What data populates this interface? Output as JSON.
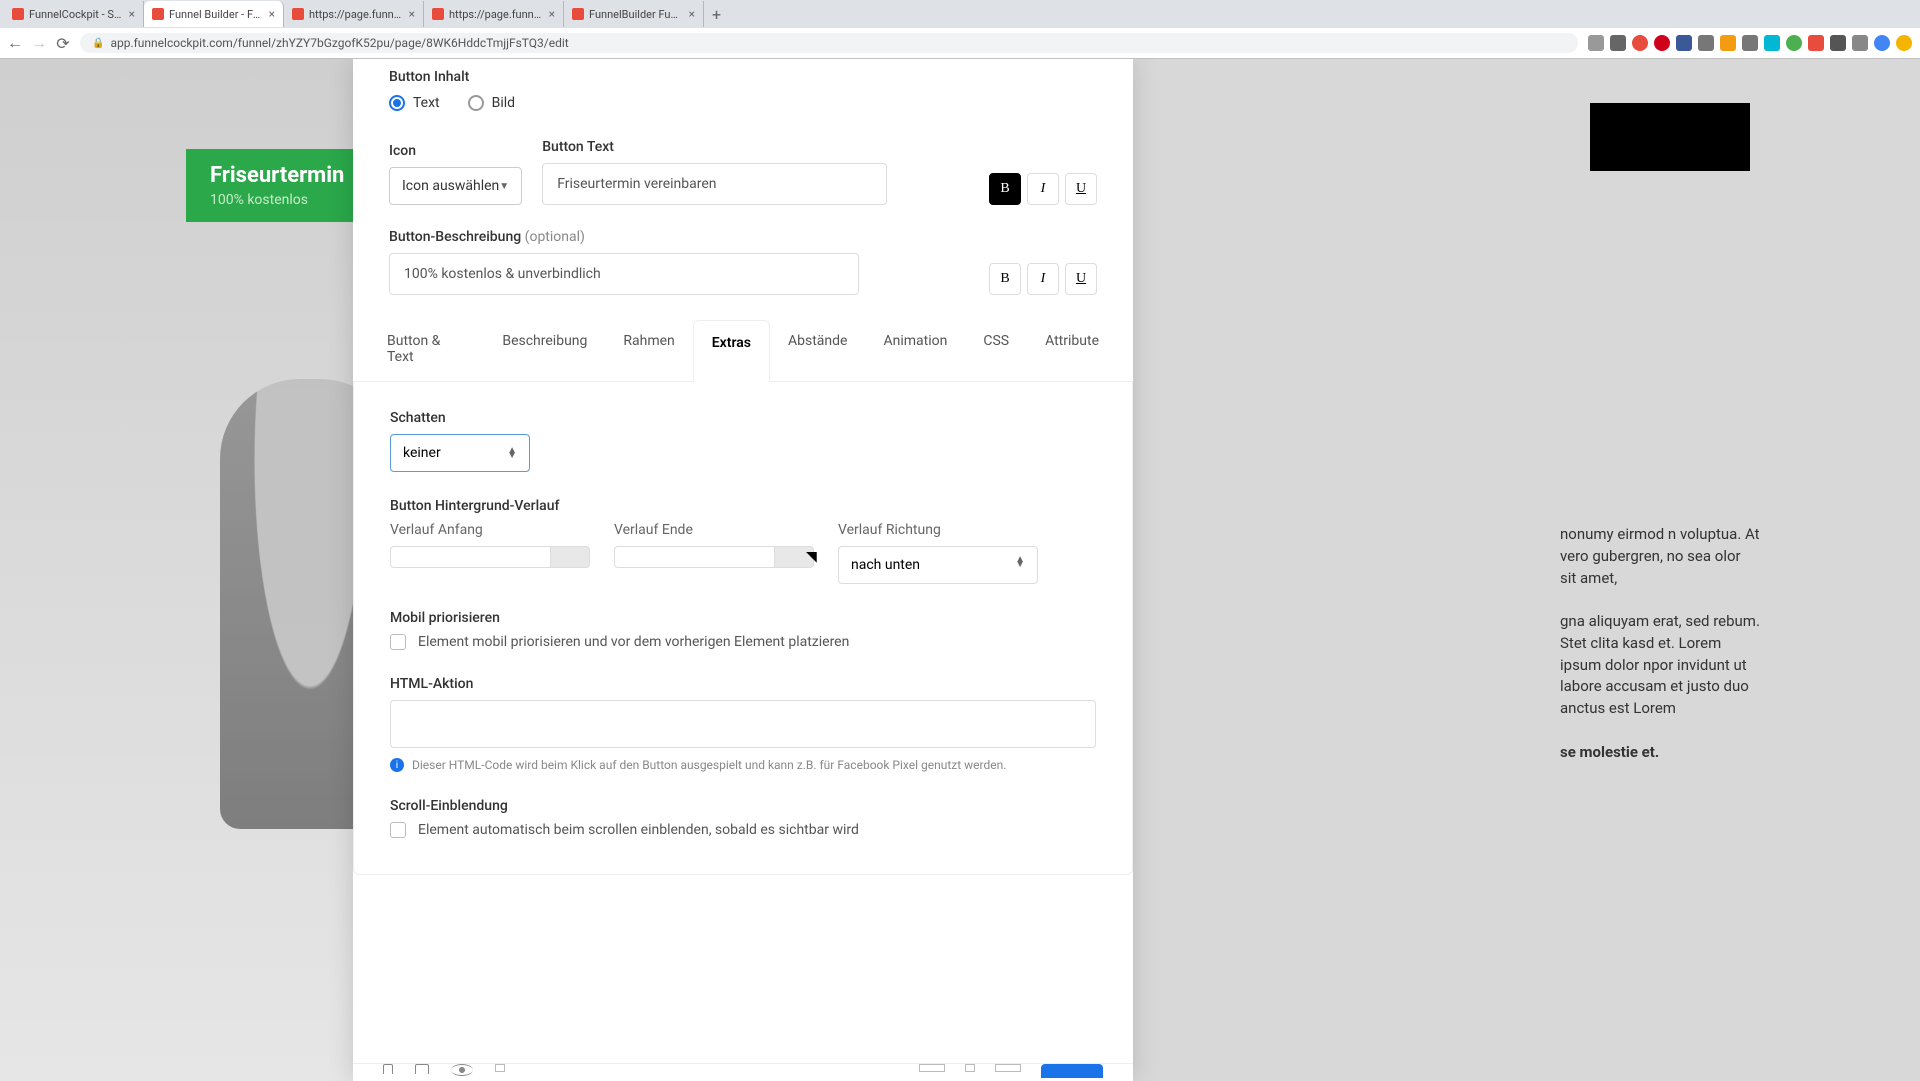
{
  "browser": {
    "tabs": [
      {
        "title": "FunnelCockpit - Splittests, Ma",
        "active": false
      },
      {
        "title": "Funnel Builder - FunnelCockpit",
        "active": true
      },
      {
        "title": "https://page.funnelcockpit.co",
        "active": false
      },
      {
        "title": "https://page.funnelcockpit.co",
        "active": false
      },
      {
        "title": "FunnelBuilder Funktionen & Ei",
        "active": false
      }
    ],
    "url": "app.funnelcockpit.com/funnel/zhYZY7bGzgofK52pu/page/8WK6HddcTmjjFsTQ3/edit"
  },
  "background": {
    "button_line1": "Friseurtermin",
    "button_line2": "100% kostenlos",
    "lorem1": "nonumy eirmod n voluptua. At vero gubergren, no sea olor sit amet,",
    "lorem2": "gna aliquyam erat, sed  rebum. Stet clita kasd et. Lorem ipsum dolor npor invidunt ut labore accusam et justo duo anctus est Lorem",
    "lorem3": "se molestie et."
  },
  "form": {
    "button_inhalt_label": "Button Inhalt",
    "radio_text": "Text",
    "radio_bild": "Bild",
    "icon_label": "Icon",
    "icon_select": "Icon auswählen",
    "button_text_label": "Button Text",
    "button_text_value": "Friseurtermin vereinbaren",
    "desc_label": "Button-Beschreibung",
    "desc_optional": "(optional)",
    "desc_value": "100% kostenlos & unverbindlich",
    "tabs": [
      "Button & Text",
      "Beschreibung",
      "Rahmen",
      "Extras",
      "Abstände",
      "Animation",
      "CSS",
      "Attribute"
    ],
    "active_tab": 3,
    "schatten_label": "Schatten",
    "schatten_value": "keiner",
    "gradient_label": "Button Hintergrund-Verlauf",
    "grad_start_label": "Verlauf Anfang",
    "grad_end_label": "Verlauf Ende",
    "grad_dir_label": "Verlauf Richtung",
    "grad_dir_value": "nach unten",
    "mobil_label": "Mobil priorisieren",
    "mobil_check": "Element mobil priorisieren und vor dem vorherigen Element platzieren",
    "html_label": "HTML-Aktion",
    "html_info": "Dieser HTML-Code wird beim Klick auf den Button ausgespielt und kann z.B. für Facebook Pixel genutzt werden.",
    "scroll_label": "Scroll-Einblendung",
    "scroll_check": "Element automatisch beim scrollen einblenden, sobald es sichtbar wird"
  },
  "fmt": {
    "b": "B",
    "i": "I",
    "u": "U"
  }
}
